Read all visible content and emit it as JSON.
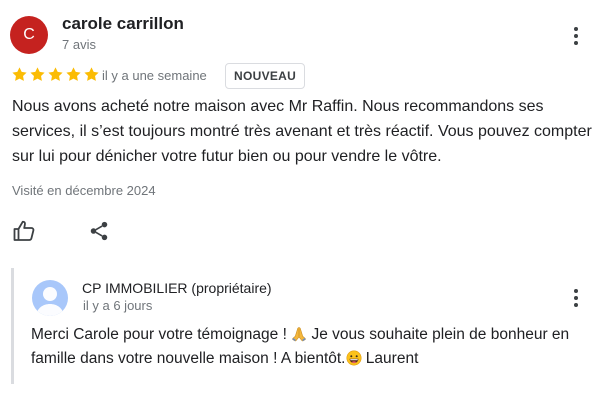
{
  "review": {
    "avatar_letter": "C",
    "avatar_color": "#c5221f",
    "reviewer_name": "carole carrillon",
    "review_count": "7 avis",
    "rating": 5,
    "date": "il y a une semaine",
    "badge": "NOUVEAU",
    "text": "Nous avons acheté notre maison avec Mr Raffin. Nous recommandons ses services, il s’est toujours montré très avenant et très réactif. Vous pouvez compter sur lui pour dénicher votre futur bien ou pour vendre le vôtre.",
    "visited": "Visité en décembre 2024",
    "star_color": "#fbbc04"
  },
  "reply": {
    "owner_name": "CP IMMOBILIER (propriétaire)",
    "date": "il y a 6 jours",
    "text_part1": "Merci Carole pour votre témoignage ! ",
    "text_part2": " Je vous souhaite plein de bonheur en famille dans votre nouvelle maison ! A bientôt.",
    "text_part3": "  Laurent",
    "avatar_color": "#a8c7fa"
  },
  "icons": {
    "menu": "more-vert-icon",
    "like": "thumbs-up-icon",
    "share": "share-icon",
    "emoji1": "folded-hands-emoji",
    "emoji2": "grinning-face-emoji"
  }
}
